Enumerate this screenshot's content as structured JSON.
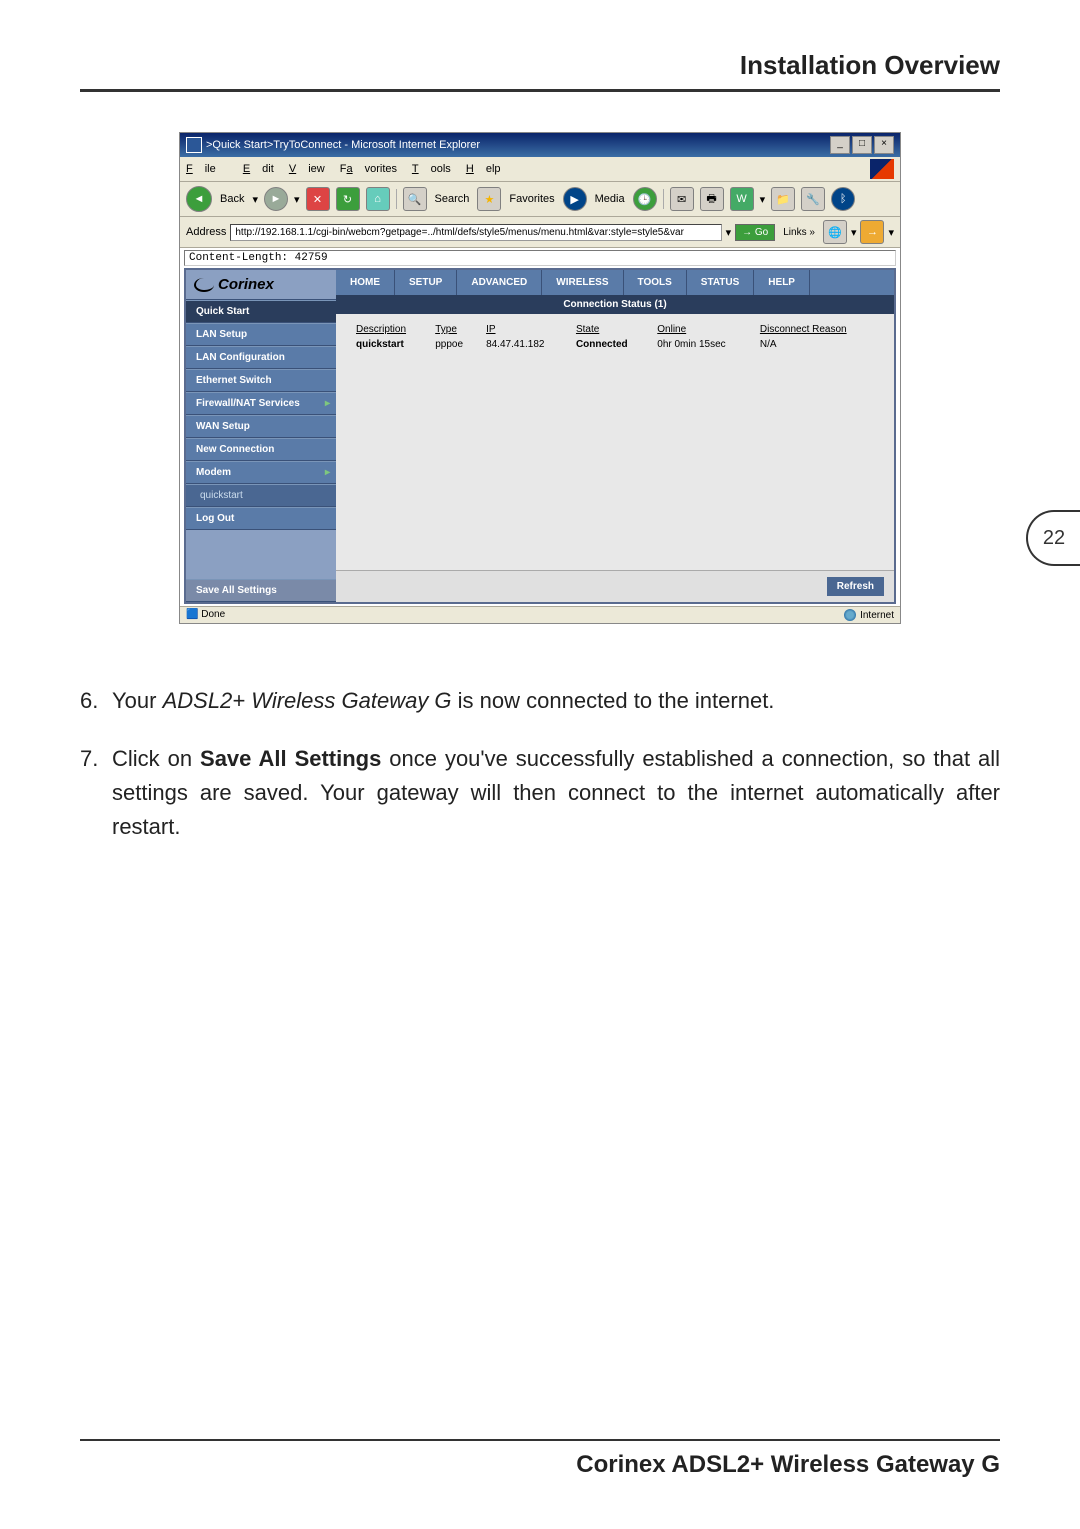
{
  "header": {
    "title": "Installation Overview"
  },
  "page_number": "22",
  "footer": {
    "text": "Corinex ADSL2+ Wireless Gateway G"
  },
  "screenshot": {
    "titlebar": ">Quick Start>TryToConnect - Microsoft Internet Explorer",
    "menu": {
      "file": "File",
      "edit": "Edit",
      "view": "View",
      "favorites": "Favorites",
      "tools": "Tools",
      "help": "Help"
    },
    "toolbar": {
      "back": "Back",
      "search": "Search",
      "favorites_btn": "Favorites",
      "media": "Media"
    },
    "address": {
      "label": "Address",
      "url": "http://192.168.1.1/cgi-bin/webcm?getpage=../html/defs/style5/menus/menu.html&var:style=style5&var",
      "go": "Go",
      "links": "Links"
    },
    "content_length": "Content-Length: 42759",
    "brand": "Corinex",
    "tabs": {
      "home": "HOME",
      "setup": "SETUP",
      "advanced": "ADVANCED",
      "wireless": "WIRELESS",
      "tools": "TOOLS",
      "status": "STATUS",
      "help": "HELP"
    },
    "sidebar": {
      "quick_start": "Quick Start",
      "lan_setup": "LAN Setup",
      "lan_config": "LAN Configuration",
      "ethernet_switch": "Ethernet Switch",
      "firewall": "Firewall/NAT Services",
      "wan_setup": "WAN Setup",
      "new_conn": "New Connection",
      "modem": "Modem",
      "quickstart": "quickstart",
      "log_out": "Log Out",
      "save_all": "Save All Settings"
    },
    "connection": {
      "header": "Connection Status (1)",
      "cols": {
        "description": "Description",
        "type": "Type",
        "ip": "IP",
        "state": "State",
        "online": "Online",
        "disconnect": "Disconnect Reason"
      },
      "row": {
        "description": "quickstart",
        "type": "pppoe",
        "ip": "84.47.41.182",
        "state": "Connected",
        "online": "0hr 0min 15sec",
        "disconnect": "N/A"
      },
      "refresh": "Refresh"
    },
    "status": {
      "done": "Done",
      "zone": "Internet"
    }
  },
  "text": {
    "para6_num": "6.",
    "para6_a": "Your ",
    "para6_b": "ADSL2+ Wireless Gateway G",
    "para6_c": " is now connected to the internet.",
    "para7_num": "7.",
    "para7_a": "Click on ",
    "para7_b": "Save All Settings",
    "para7_c": " once you've successfully established a connection, so that all settings are saved. Your gateway will then connect to the internet automatically after restart."
  }
}
